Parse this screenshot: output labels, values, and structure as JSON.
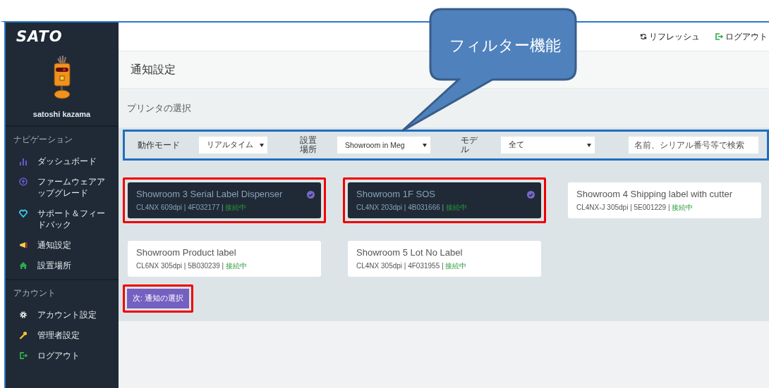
{
  "sidebar": {
    "logo": "SATO",
    "user_name": "satoshi kazama",
    "sections": [
      {
        "heading": "ナビゲーション",
        "items": [
          {
            "label": "ダッシュボード",
            "kind": "chart"
          },
          {
            "label": "ファームウェアアップグレード",
            "kind": "upload"
          },
          {
            "label": "サポート＆フィードバック",
            "kind": "heart"
          },
          {
            "label": "通知設定",
            "kind": "megaphone"
          },
          {
            "label": "設置場所",
            "kind": "home"
          }
        ]
      },
      {
        "heading": "アカウント",
        "items": [
          {
            "label": "アカウント設定",
            "kind": "gear"
          },
          {
            "label": "管理者設定",
            "kind": "wrench"
          },
          {
            "label": "ログアウト",
            "kind": "logout"
          }
        ]
      }
    ]
  },
  "topbar": {
    "refresh": "リフレッシュ",
    "logout": "ログアウト"
  },
  "page_title": "通知設定",
  "section_title": "プリンタの選択",
  "filters": {
    "highlighted": true,
    "fields": [
      {
        "label": "動作モード",
        "value": "リアルタイム"
      },
      {
        "label": "設置場所",
        "value": "Showroom in Meg"
      },
      {
        "label": "モデル",
        "value": "全て"
      }
    ],
    "search": {
      "placeholder": "名前、シリアル番号等で検索"
    }
  },
  "printers": [
    {
      "name": "Showroom 3 Serial Label Dispenser",
      "details": "CL4NX 609dpi | 4F032177 | ",
      "status": "接続中",
      "selected": true
    },
    {
      "name": "Showroom 1F SOS",
      "details": "CL4NX 203dpi | 4B031666 | ",
      "status": "接続中",
      "selected": true
    },
    {
      "name": "Showroom 4 Shipping label with cutter",
      "details": "CL4NX-J 305dpi | 5E001229 | ",
      "status": "接続中",
      "selected": false
    },
    {
      "name": "Showroom Product label",
      "details": "CL6NX 305dpi | 5B030239 | ",
      "status": "接続中",
      "selected": false
    },
    {
      "name": "Showroom 5 Lot No Label",
      "details": "CL4NX 305dpi | 4F031955 | ",
      "status": "接続中",
      "selected": false
    }
  ],
  "next_button": {
    "label": "次: 通知の選択",
    "highlighted": true
  },
  "callout": {
    "text": "フィルター機能"
  }
}
